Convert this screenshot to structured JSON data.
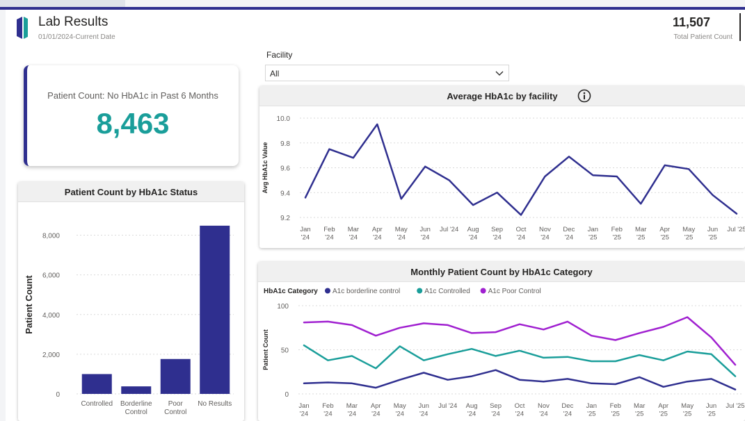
{
  "header": {
    "title": "Lab Results",
    "subtitle": "01/01/2024-Current Date",
    "total_value": "11,507",
    "total_label": "Total Patient Count"
  },
  "kpi": {
    "label": "Patient Count: No HbA1c in Past 6 Months",
    "value": "8,463"
  },
  "filter": {
    "label": "Facility",
    "value": "All"
  },
  "colors": {
    "navy": "#2f2f8f",
    "teal": "#1a9e9a",
    "purple": "#a020d0",
    "kpi_value": "#1a9e9a"
  },
  "chart_data": [
    {
      "type": "bar",
      "title": "Patient Count by HbA1c Status",
      "ylabel": "Patient Count",
      "xlabel": "",
      "categories": [
        "Controlled",
        "Borderline\nControl",
        "Poor\nControl",
        "No Results"
      ],
      "values": [
        1000,
        380,
        1760,
        8480
      ],
      "ylim": [
        0,
        9000
      ],
      "yticks": [
        0,
        2000,
        4000,
        6000,
        8000
      ],
      "ytick_labels": [
        "0",
        "2,000",
        "4,000",
        "6,000",
        "8,000"
      ],
      "grid": true,
      "color": "#2f2f8f"
    },
    {
      "type": "line",
      "title": "Average HbA1c by facility",
      "ylabel": "Avg HbA1c Value",
      "xlabel": "",
      "x": [
        "Jan\n'24",
        "Feb\n'24",
        "Mar\n'24",
        "Apr\n'24",
        "May\n'24",
        "Jun\n'24",
        "Jul '24",
        "Aug\n'24",
        "Sep\n'24",
        "Oct\n'24",
        "Nov\n'24",
        "Dec\n'24",
        "Jan\n'25",
        "Feb\n'25",
        "Mar\n'25",
        "Apr\n'25",
        "May\n'25",
        "Jun\n'25",
        "Jul '25"
      ],
      "series": [
        {
          "values": [
            9.36,
            9.75,
            9.68,
            9.95,
            9.35,
            9.61,
            9.5,
            9.3,
            9.4,
            9.22,
            9.53,
            9.69,
            9.54,
            9.53,
            9.31,
            9.62,
            9.59,
            9.38,
            9.23
          ],
          "color": "#2f2f8f"
        }
      ],
      "ylim": [
        9.2,
        10.0
      ],
      "yticks": [
        9.2,
        9.4,
        9.6,
        9.8,
        10.0
      ],
      "ytick_labels": [
        "9.2",
        "9.4",
        "9.6",
        "9.8",
        "10.0"
      ],
      "grid": true
    },
    {
      "type": "line",
      "title": "Monthly Patient Count by HbA1c Category",
      "ylabel": "Patient Count",
      "xlabel": "",
      "legend_title": "HbA1c Category",
      "legend_position": "top-left",
      "x": [
        "Jan\n'24",
        "Feb\n'24",
        "Mar\n'24",
        "Apr\n'24",
        "May\n'24",
        "Jun\n'24",
        "Jul '24",
        "Aug\n'24",
        "Sep\n'24",
        "Oct\n'24",
        "Nov\n'24",
        "Dec\n'24",
        "Jan\n'25",
        "Feb\n'25",
        "Mar\n'25",
        "Apr\n'25",
        "May\n'25",
        "Jun\n'25",
        "Jul '25"
      ],
      "series": [
        {
          "name": "A1c borderline control",
          "color": "#2f2f8f",
          "values": [
            12,
            13,
            12,
            7,
            16,
            24,
            16,
            20,
            27,
            16,
            14,
            17,
            12,
            11,
            19,
            8,
            14,
            17,
            5
          ]
        },
        {
          "name": "A1c Controlled",
          "color": "#1a9e9a",
          "values": [
            55,
            38,
            43,
            29,
            54,
            38,
            45,
            51,
            43,
            49,
            41,
            42,
            37,
            37,
            44,
            38,
            48,
            45,
            20
          ]
        },
        {
          "name": "A1c Poor Control",
          "color": "#a020d0",
          "values": [
            81,
            82,
            78,
            66,
            75,
            80,
            78,
            69,
            70,
            79,
            73,
            82,
            66,
            61,
            69,
            76,
            87,
            64,
            33
          ]
        }
      ],
      "ylim": [
        0,
        100
      ],
      "yticks": [
        0,
        50,
        100
      ],
      "ytick_labels": [
        "0",
        "50",
        "100"
      ],
      "grid": true
    }
  ]
}
